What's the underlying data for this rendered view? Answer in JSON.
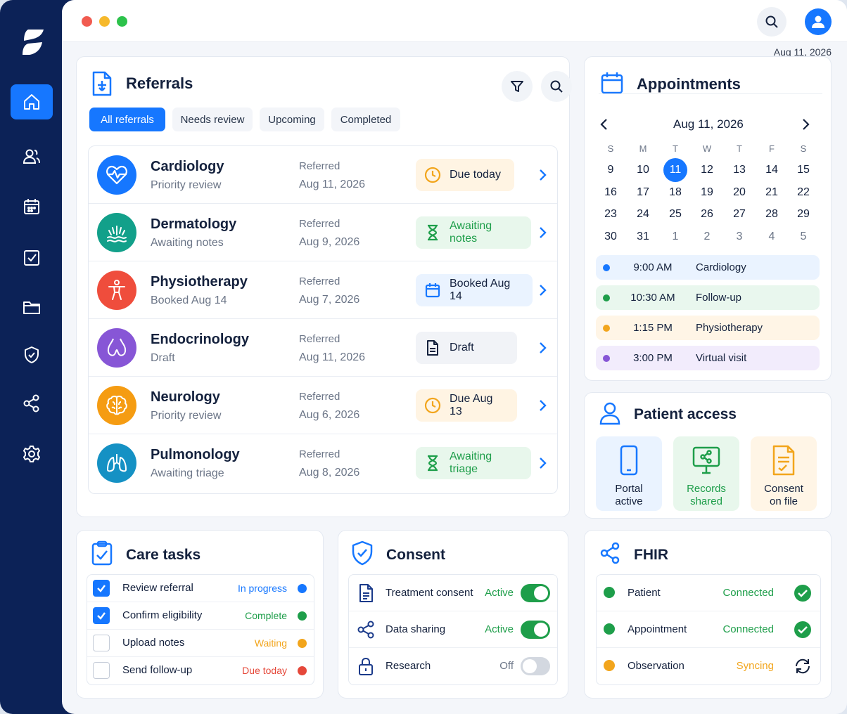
{
  "header": {
    "date": "Aug 11, 2026"
  },
  "colors": {
    "primary": "#1677ff",
    "sidebar": "#0c2257",
    "success": "#1e9e4a",
    "warning": "#f2a51c",
    "danger": "#e5483a"
  },
  "sidebar": {
    "items": [
      {
        "icon": "home-icon"
      },
      {
        "icon": "users-icon"
      },
      {
        "icon": "calendar-icon"
      },
      {
        "icon": "checklist-icon"
      },
      {
        "icon": "folder-icon"
      },
      {
        "icon": "shield-check-icon"
      },
      {
        "icon": "share-icon"
      },
      {
        "icon": "settings-icon"
      }
    ]
  },
  "referrals": {
    "title": "Referrals",
    "tabs": [
      "All referrals",
      "Needs review",
      "Upcoming",
      "Completed"
    ],
    "active_tab": "All referrals",
    "rows": [
      {
        "name": "Cardiology",
        "subtitle": "Priority review",
        "label": "Referred",
        "date": "Aug 11, 2026",
        "status": "Due today",
        "status_type": "warning",
        "icon": "heart-pulse-icon"
      },
      {
        "name": "Dermatology",
        "subtitle": "Awaiting notes",
        "label": "Referred",
        "date": "Aug 9, 2026",
        "status": "Awaiting notes",
        "status_type": "pending",
        "icon": "skin-icon"
      },
      {
        "name": "Physiotherapy",
        "subtitle": "Booked Aug 14",
        "label": "Referred",
        "date": "Aug 7, 2026",
        "status": "Booked Aug 14",
        "status_type": "booked",
        "icon": "body-icon"
      },
      {
        "name": "Endocrinology",
        "subtitle": "Draft",
        "label": "Referred",
        "date": "Aug 11, 2026",
        "status": "Draft",
        "status_type": "draft",
        "icon": "thyroid-icon"
      },
      {
        "name": "Neurology",
        "subtitle": "Priority review",
        "label": "Referred",
        "date": "Aug 6, 2026",
        "status": "Due Aug 13",
        "status_type": "warning",
        "icon": "brain-icon"
      },
      {
        "name": "Pulmonology",
        "subtitle": "Awaiting triage",
        "label": "Referred",
        "date": "Aug 8, 2026",
        "status": "Awaiting triage",
        "status_type": "pending",
        "icon": "lungs-icon"
      }
    ]
  },
  "appointments": {
    "title": "Appointments",
    "month_label": "Aug 11, 2026",
    "weekdays": [
      "S",
      "M",
      "T",
      "W",
      "T",
      "F",
      "S"
    ],
    "weeks": [
      [
        "9",
        "10",
        "11",
        "12",
        "13",
        "14",
        "15"
      ],
      [
        "16",
        "17",
        "18",
        "19",
        "20",
        "21",
        "22"
      ],
      [
        "23",
        "24",
        "25",
        "26",
        "27",
        "28",
        "29"
      ],
      [
        "30",
        "31",
        "1",
        "2",
        "3",
        "4",
        "5"
      ]
    ],
    "selected_day": "11",
    "items": [
      {
        "time": "9:00 AM",
        "name": "Cardiology",
        "color": "#1677ff",
        "bg": "#eaf3ff"
      },
      {
        "time": "10:30 AM",
        "name": "Follow-up",
        "color": "#1e9e4a",
        "bg": "#e9f7ee"
      },
      {
        "time": "1:15 PM",
        "name": "Physiotherapy",
        "color": "#f2a51c",
        "bg": "#fff5e6"
      },
      {
        "time": "3:00 PM",
        "name": "Virtual visit",
        "color": "#8756d6",
        "bg": "#f2ecfc"
      }
    ]
  },
  "patient_access": {
    "title": "Patient access",
    "tiles": [
      {
        "line1": "Portal",
        "line2": "active",
        "icon": "mobile-icon"
      },
      {
        "line1": "Records",
        "line2": "shared",
        "icon": "monitor-share-icon"
      },
      {
        "line1": "Consent",
        "line2": "on file",
        "icon": "document-check-icon"
      }
    ]
  },
  "care_tasks": {
    "title": "Care tasks",
    "items": [
      {
        "name": "Review referral",
        "status": "In progress",
        "checked": true,
        "color": "#1677ff"
      },
      {
        "name": "Confirm eligibility",
        "status": "Complete",
        "checked": true,
        "color": "#1e9e4a"
      },
      {
        "name": "Upload notes",
        "status": "Waiting",
        "checked": false,
        "color": "#f2a51c"
      },
      {
        "name": "Send follow-up",
        "status": "Due today",
        "checked": false,
        "color": "#e5483a"
      }
    ]
  },
  "consent": {
    "title": "Consent",
    "items": [
      {
        "name": "Treatment consent",
        "status": "Active",
        "on": true,
        "icon": "document-icon"
      },
      {
        "name": "Data sharing",
        "status": "Active",
        "on": true,
        "icon": "share-icon"
      },
      {
        "name": "Research",
        "status": "Off",
        "on": false,
        "icon": "lock-icon"
      }
    ]
  },
  "fhir": {
    "title": "FHIR",
    "items": [
      {
        "name": "Patient",
        "status": "Connected",
        "color": "#1e9e4a"
      },
      {
        "name": "Appointment",
        "status": "Connected",
        "color": "#1e9e4a"
      },
      {
        "name": "Observation",
        "status": "Syncing",
        "color": "#f2a51c"
      }
    ]
  }
}
